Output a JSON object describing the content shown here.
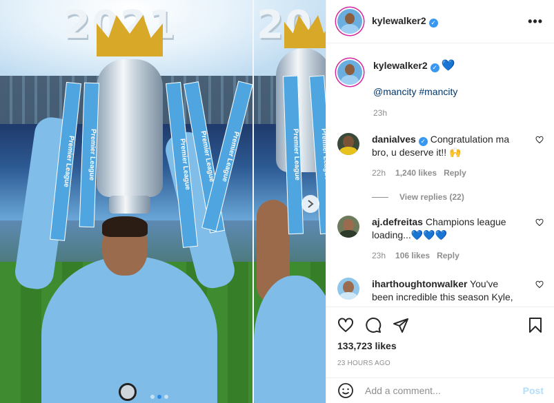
{
  "media": {
    "year_left": "2021",
    "year_right": "20",
    "ribbon_text": "Premier League",
    "carousel": {
      "count": 3,
      "active": 1
    }
  },
  "post": {
    "username": "kylewalker2",
    "more": "•••",
    "caption": {
      "username": "kylewalker2",
      "emoji": "💙",
      "tags": "@mancity #mancity",
      "time": "23h"
    },
    "comments": [
      {
        "username": "danialves",
        "verified": true,
        "text": "Congratulation ma bro, u deserve it!! 🙌",
        "time": "22h",
        "likes": "1,240 likes",
        "reply": "Reply",
        "view_replies": "View replies (22)"
      },
      {
        "username": "aj.defreitas",
        "verified": false,
        "text": "Champions league loading...💙💙💙",
        "time": "23h",
        "likes": "106 likes",
        "reply": "Reply"
      },
      {
        "username": "iharthoughtonwalker",
        "verified": false,
        "text": "You've been incredible this season Kyle,",
        "time": "",
        "likes": "",
        "reply": ""
      }
    ],
    "likes": "133,723 likes",
    "timestamp": "23 HOURS AGO",
    "add_comment_placeholder": "Add a comment...",
    "post_button": "Post"
  },
  "colors": {
    "link": "#00376b",
    "verified": "#3897f0",
    "muted": "#8e8e8e",
    "post_disabled": "#b2dffc"
  }
}
